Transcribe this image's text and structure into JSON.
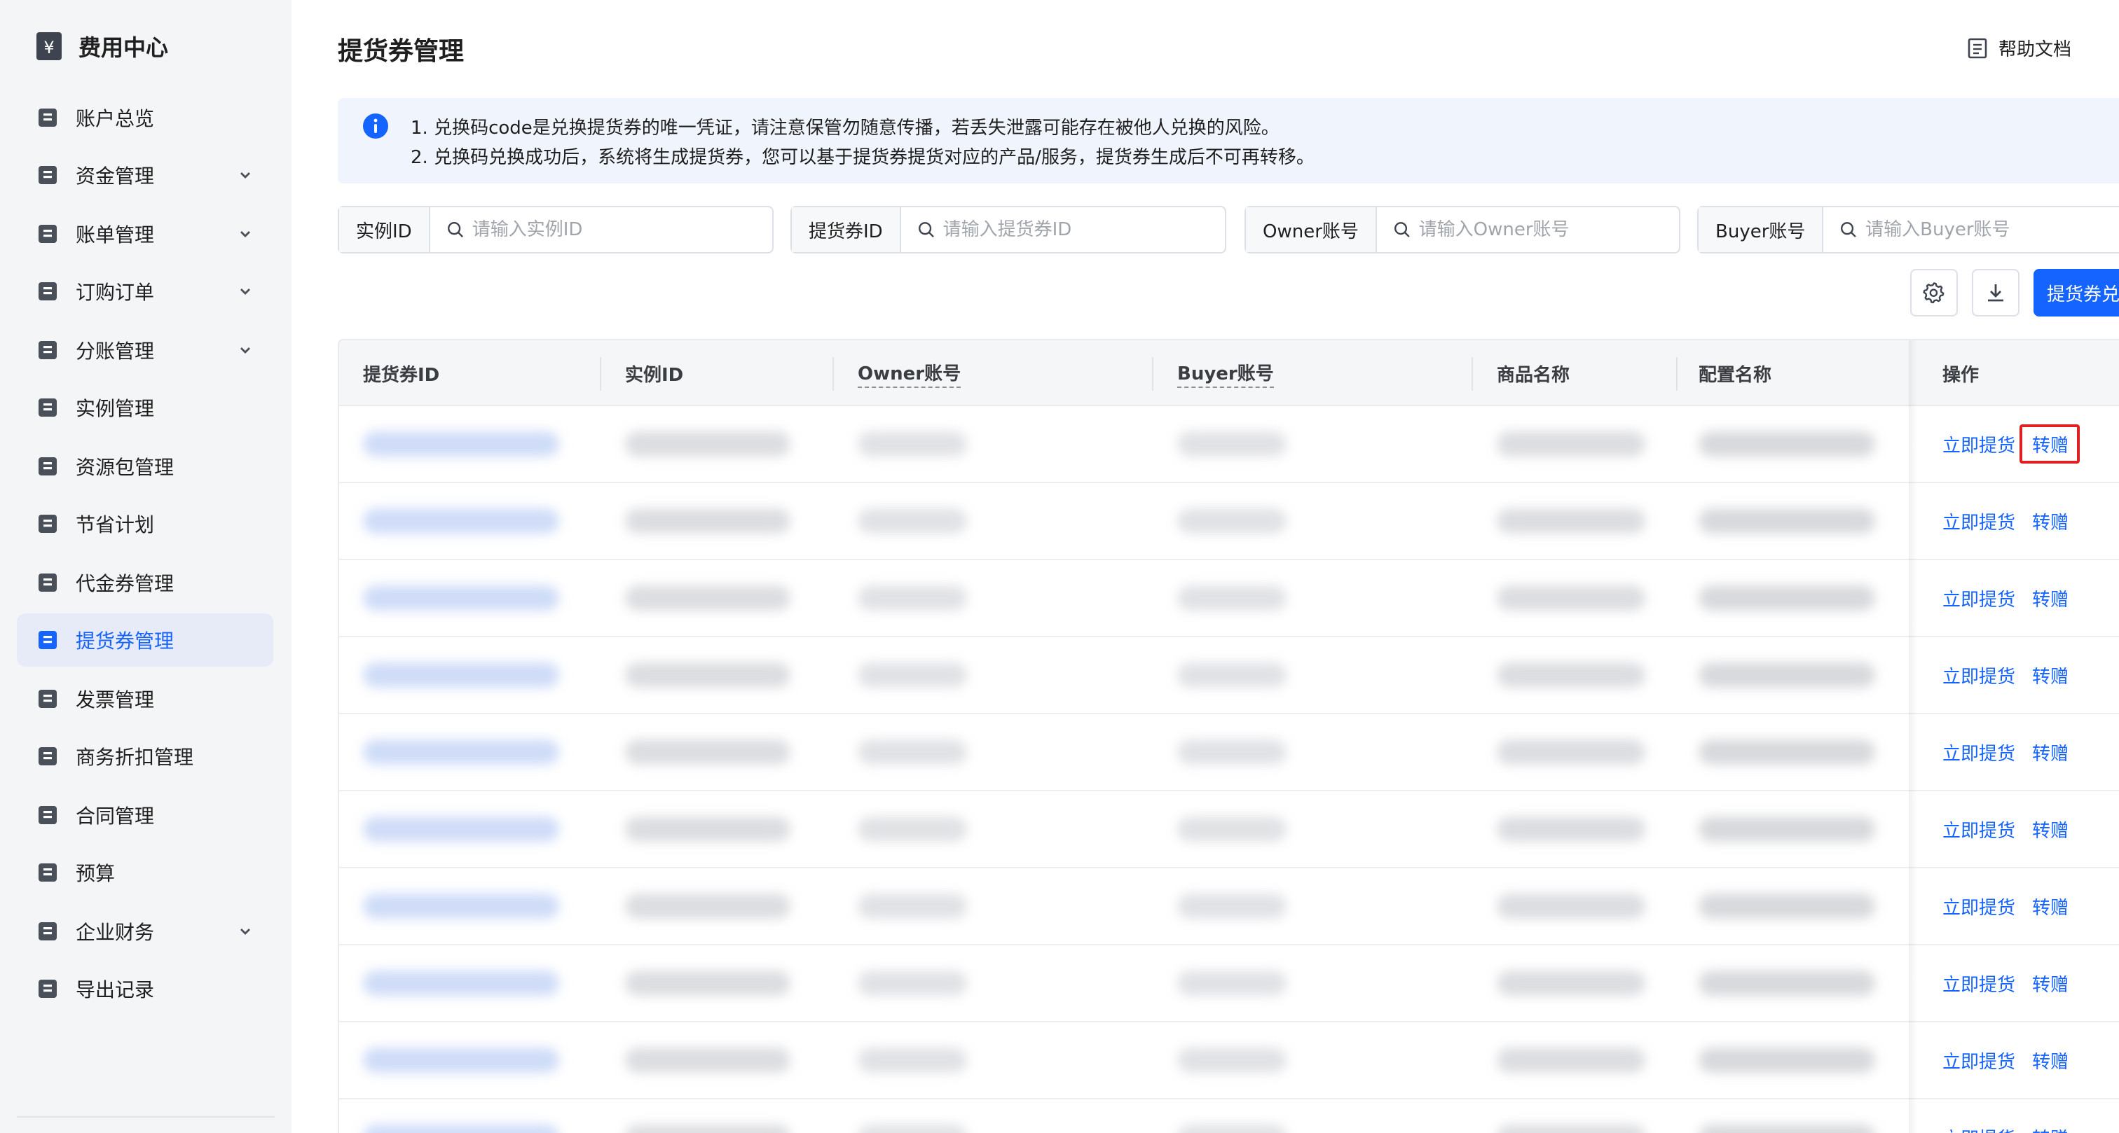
{
  "sidebar": {
    "title": "费用中心",
    "items": [
      {
        "label": "账户总览",
        "expandable": false,
        "active": false
      },
      {
        "label": "资金管理",
        "expandable": true,
        "active": false
      },
      {
        "label": "账单管理",
        "expandable": true,
        "active": false
      },
      {
        "label": "订购订单",
        "expandable": true,
        "active": false
      },
      {
        "label": "分账管理",
        "expandable": true,
        "active": false
      },
      {
        "label": "实例管理",
        "expandable": false,
        "active": false
      },
      {
        "label": "资源包管理",
        "expandable": false,
        "active": false
      },
      {
        "label": "节省计划",
        "expandable": false,
        "active": false
      },
      {
        "label": "代金券管理",
        "expandable": false,
        "active": false
      },
      {
        "label": "提货券管理",
        "expandable": false,
        "active": true
      },
      {
        "label": "发票管理",
        "expandable": false,
        "active": false
      },
      {
        "label": "商务折扣管理",
        "expandable": false,
        "active": false
      },
      {
        "label": "合同管理",
        "expandable": false,
        "active": false
      },
      {
        "label": "预算",
        "expandable": false,
        "active": false
      },
      {
        "label": "企业财务",
        "expandable": true,
        "active": false
      },
      {
        "label": "导出记录",
        "expandable": false,
        "active": false
      }
    ]
  },
  "header": {
    "title": "提货券管理",
    "help_label": "帮助文档"
  },
  "notice": {
    "line1": "1. 兑换码code是兑换提货券的唯一凭证，请注意保管勿随意传播，若丢失泄露可能存在被他人兑换的风险。",
    "line2": "2. 兑换码兑换成功后，系统将生成提货券，您可以基于提货券提货对应的产品/服务，提货券生成后不可再转移。"
  },
  "filters": [
    {
      "label": "实例ID",
      "placeholder": "请输入实例ID",
      "value": ""
    },
    {
      "label": "提货券ID",
      "placeholder": "请输入提货券ID",
      "value": ""
    },
    {
      "label": "Owner账号",
      "placeholder": "请输入Owner账号",
      "value": ""
    },
    {
      "label": "Buyer账号",
      "placeholder": "请输入Buyer账号",
      "value": ""
    }
  ],
  "toolbar": {
    "primary_label": "提货券兑换"
  },
  "table": {
    "columns": [
      "提货券ID",
      "实例ID",
      "Owner账号",
      "Buyer账号",
      "商品名称",
      "配置名称",
      "操作"
    ],
    "row_actions": [
      "立即提货",
      "转赠"
    ],
    "visible_rows": 10
  },
  "colors": {
    "accent": "#1664ff",
    "sidebar_bg": "#f4f5f7",
    "active_bg": "#e6ebf7",
    "notice_bg": "#f0f4fc",
    "highlight": "#e02020"
  }
}
